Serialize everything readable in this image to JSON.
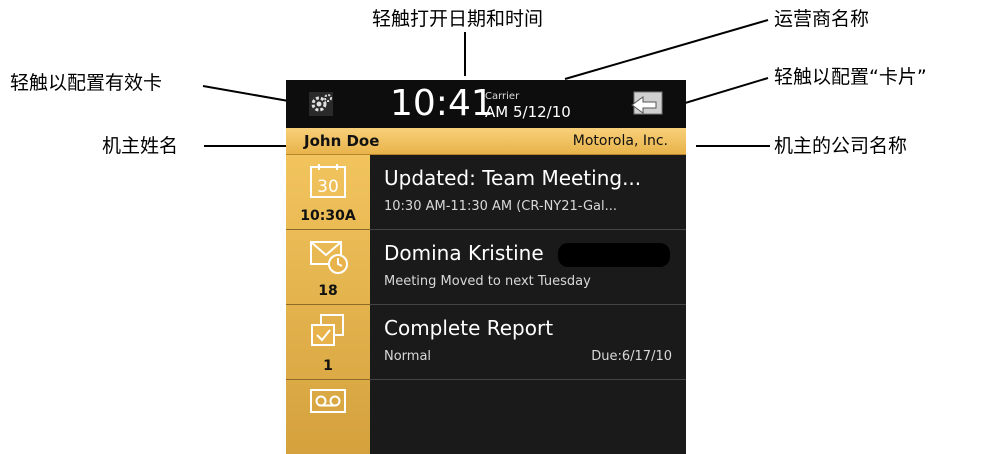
{
  "callouts": {
    "tap_datetime": "轻触打开日期和时间",
    "carrier_name": "运营商名称",
    "configure_active_cards": "轻触以配置有效卡",
    "configure_cards": "轻触以配置“卡片”",
    "owner_name": "机主姓名",
    "owner_company": "机主的公司名称"
  },
  "status": {
    "time": "10:41",
    "carrier": "Carrier",
    "ampm_date": "AM 5/12/10"
  },
  "owner": {
    "name": "John Doe",
    "company": "Motorola, Inc."
  },
  "cards": [
    {
      "icon": "calendar-icon",
      "icon_text": "30",
      "count": "10:30A",
      "title": "Updated: Team Meeting...",
      "subtitle": "10:30 AM-11:30 AM (CR-NY21-Gal...",
      "right": ""
    },
    {
      "icon": "mail-clock-icon",
      "count": "18",
      "title": "Domina Kristine",
      "subtitle": "Meeting Moved to next Tuesday",
      "right": ""
    },
    {
      "icon": "tasks-icon",
      "count": "1",
      "title": "Complete Report",
      "subtitle": "Normal",
      "right": "Due:6/17/10"
    },
    {
      "icon": "voicemail-icon",
      "count": "",
      "title": "",
      "subtitle": "",
      "right": ""
    }
  ],
  "colors": {
    "accent": "#e8b34a",
    "screen_bg": "#1a1a1a",
    "status_bg": "#0d0d0d"
  }
}
